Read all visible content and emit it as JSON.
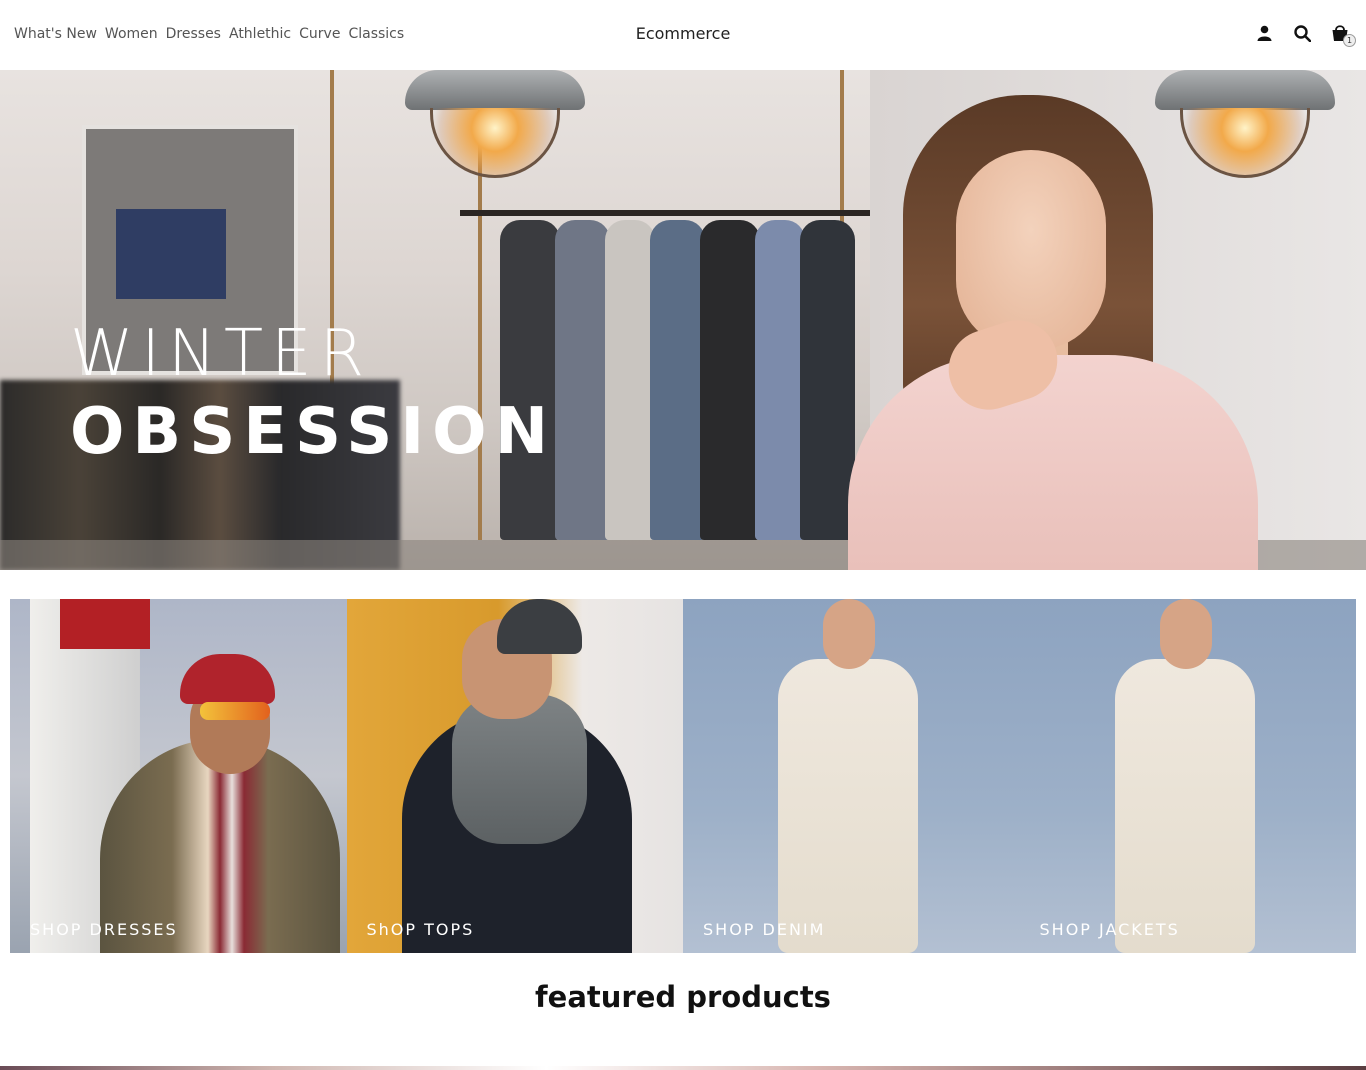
{
  "nav": {
    "links": [
      "What's New",
      "Women",
      "Dresses",
      "Athlethic",
      "Curve",
      "Classics"
    ],
    "brand": "Ecommerce",
    "icons": [
      "user-icon",
      "search-icon",
      "cart-icon"
    ],
    "cart_count": "1"
  },
  "hero": {
    "line1": "WINTER",
    "line2": "OBSESSION"
  },
  "categories": [
    {
      "label": "SHOP DRESSES"
    },
    {
      "label": "ShOP TOPS"
    },
    {
      "label": "SHOP DENIM"
    },
    {
      "label": "SHOP JACKETS"
    }
  ],
  "featured": {
    "title": "featured products"
  },
  "colors": {
    "text": "#555555",
    "accent": "#111111",
    "hero_text": "#ffffff"
  }
}
